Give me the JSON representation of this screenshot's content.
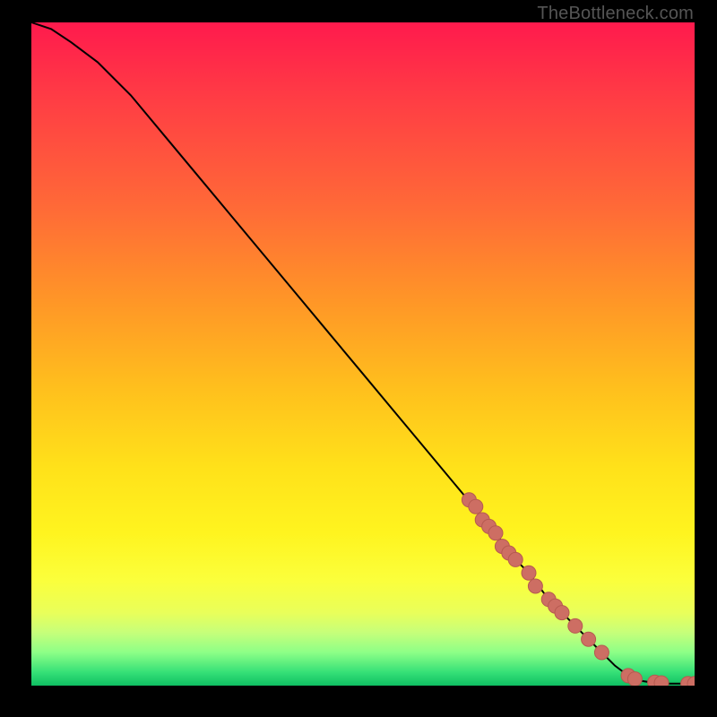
{
  "attribution": "TheBottleneck.com",
  "colors": {
    "curve": "#000000",
    "marker_fill": "#cd6e63",
    "marker_stroke": "#b65a50"
  },
  "chart_data": {
    "type": "line",
    "title": "",
    "xlabel": "",
    "ylabel": "",
    "xlim": [
      0,
      100
    ],
    "ylim": [
      0,
      100
    ],
    "grid": false,
    "series": [
      {
        "name": "bottleneck-curve",
        "x": [
          0,
          3,
          6,
          10,
          15,
          20,
          25,
          30,
          35,
          40,
          45,
          50,
          55,
          60,
          65,
          70,
          73,
          75,
          78,
          80,
          82,
          84,
          86,
          88,
          90,
          92,
          94,
          96,
          98,
          100
        ],
        "y": [
          100,
          99,
          97,
          94,
          89,
          83,
          77,
          71,
          65,
          59,
          53,
          47,
          41,
          35,
          29,
          23,
          19,
          17,
          13,
          11,
          9,
          7,
          5,
          3,
          1.5,
          0.7,
          0.4,
          0.3,
          0.3,
          0.3
        ]
      }
    ],
    "markers": {
      "name": "highlighted-points",
      "x": [
        66,
        67,
        68,
        69,
        70,
        71,
        72,
        73,
        75,
        76,
        78,
        79,
        80,
        82,
        84,
        86,
        90,
        91,
        94,
        95,
        99,
        100
      ],
      "y": [
        28,
        27,
        25,
        24,
        23,
        21,
        20,
        19,
        17,
        15,
        13,
        12,
        11,
        9,
        7,
        5,
        1.5,
        1.0,
        0.5,
        0.4,
        0.3,
        0.3
      ]
    }
  }
}
